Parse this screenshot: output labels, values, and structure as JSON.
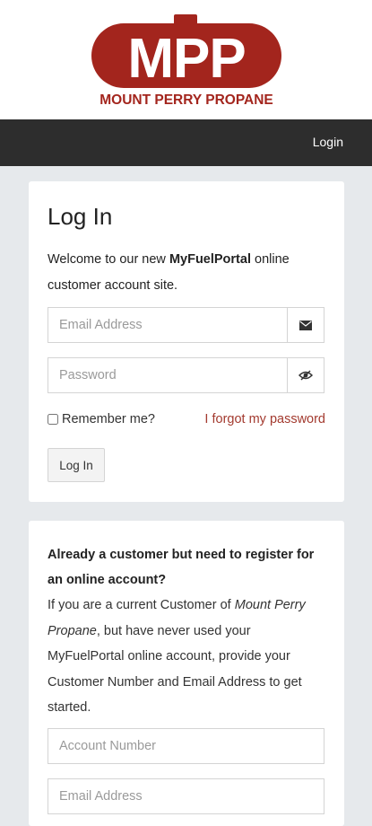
{
  "brand": {
    "logo_letters": "MPP",
    "logo_name": "MOUNT PERRY PROPANE",
    "logo_color": "#a3251d"
  },
  "nav": {
    "login_label": "Login"
  },
  "login_card": {
    "title": "Log In",
    "welcome_prefix": "Welcome to our new ",
    "welcome_bold": "MyFuelPortal",
    "welcome_suffix": " online customer account site.",
    "email_placeholder": "Email Address",
    "password_placeholder": "Password",
    "email_icon": "envelope-icon",
    "password_icon": "eye-slash-icon",
    "remember_label": "Remember me?",
    "forgot_label": "I forgot my password",
    "login_button": "Log In",
    "link_color": "#a33a2f"
  },
  "register_card": {
    "heading": "Already a customer but need to register for an online account?",
    "text_prefix": "If you are a current Customer of ",
    "company_name": "Mount Perry Propane",
    "text_suffix": ", but have never used your MyFuelPortal online account, provide your Customer Number and Email Address to get started.",
    "account_placeholder": "Account Number",
    "email_placeholder": "Email Address"
  }
}
